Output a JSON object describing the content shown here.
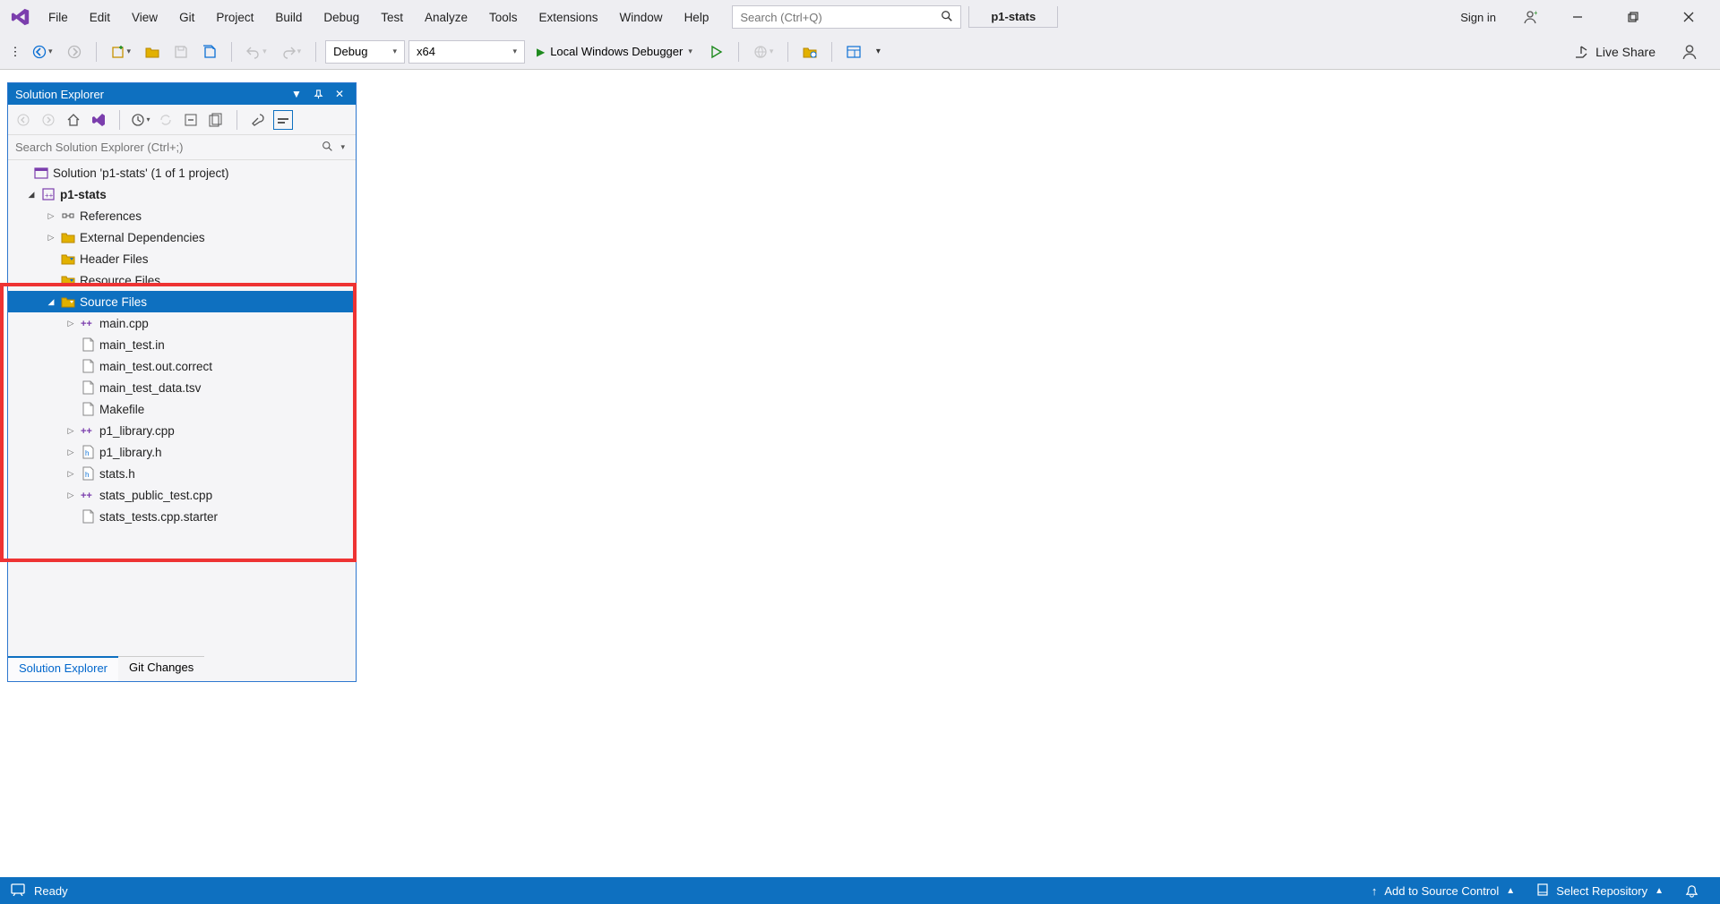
{
  "menu": {
    "items": [
      "File",
      "Edit",
      "View",
      "Git",
      "Project",
      "Build",
      "Debug",
      "Test",
      "Analyze",
      "Tools",
      "Extensions",
      "Window",
      "Help"
    ]
  },
  "search": {
    "placeholder": "Search (Ctrl+Q)"
  },
  "solution_name_box": "p1-stats",
  "signin": "Sign in",
  "toolbar": {
    "config": "Debug",
    "platform": "x64",
    "debugger_label": "Local Windows Debugger"
  },
  "liveshare": "Live Share",
  "solution_explorer": {
    "title": "Solution Explorer",
    "search_placeholder": "Search Solution Explorer (Ctrl+;)",
    "root_label": "Solution 'p1-stats' (1 of 1 project)",
    "project_label": "p1-stats",
    "folders": {
      "references": "References",
      "external_deps": "External Dependencies",
      "header_files": "Header Files",
      "resource_files": "Resource Files",
      "source_files": "Source Files"
    },
    "source_files_items": [
      {
        "expander": "closed",
        "icon": "cpp",
        "label": "main.cpp"
      },
      {
        "expander": "",
        "icon": "file",
        "label": "main_test.in"
      },
      {
        "expander": "",
        "icon": "file",
        "label": "main_test.out.correct"
      },
      {
        "expander": "",
        "icon": "file",
        "label": "main_test_data.tsv"
      },
      {
        "expander": "",
        "icon": "file",
        "label": "Makefile"
      },
      {
        "expander": "closed",
        "icon": "cpp",
        "label": "p1_library.cpp"
      },
      {
        "expander": "closed",
        "icon": "h",
        "label": "p1_library.h"
      },
      {
        "expander": "closed",
        "icon": "h",
        "label": "stats.h"
      },
      {
        "expander": "closed",
        "icon": "cpp",
        "label": "stats_public_test.cpp"
      },
      {
        "expander": "",
        "icon": "file",
        "label": "stats_tests.cpp.starter"
      }
    ],
    "tabs": {
      "active": "Solution Explorer",
      "other": "Git Changes"
    }
  },
  "statusbar": {
    "ready": "Ready",
    "source_control": "Add to Source Control",
    "repo": "Select Repository"
  }
}
